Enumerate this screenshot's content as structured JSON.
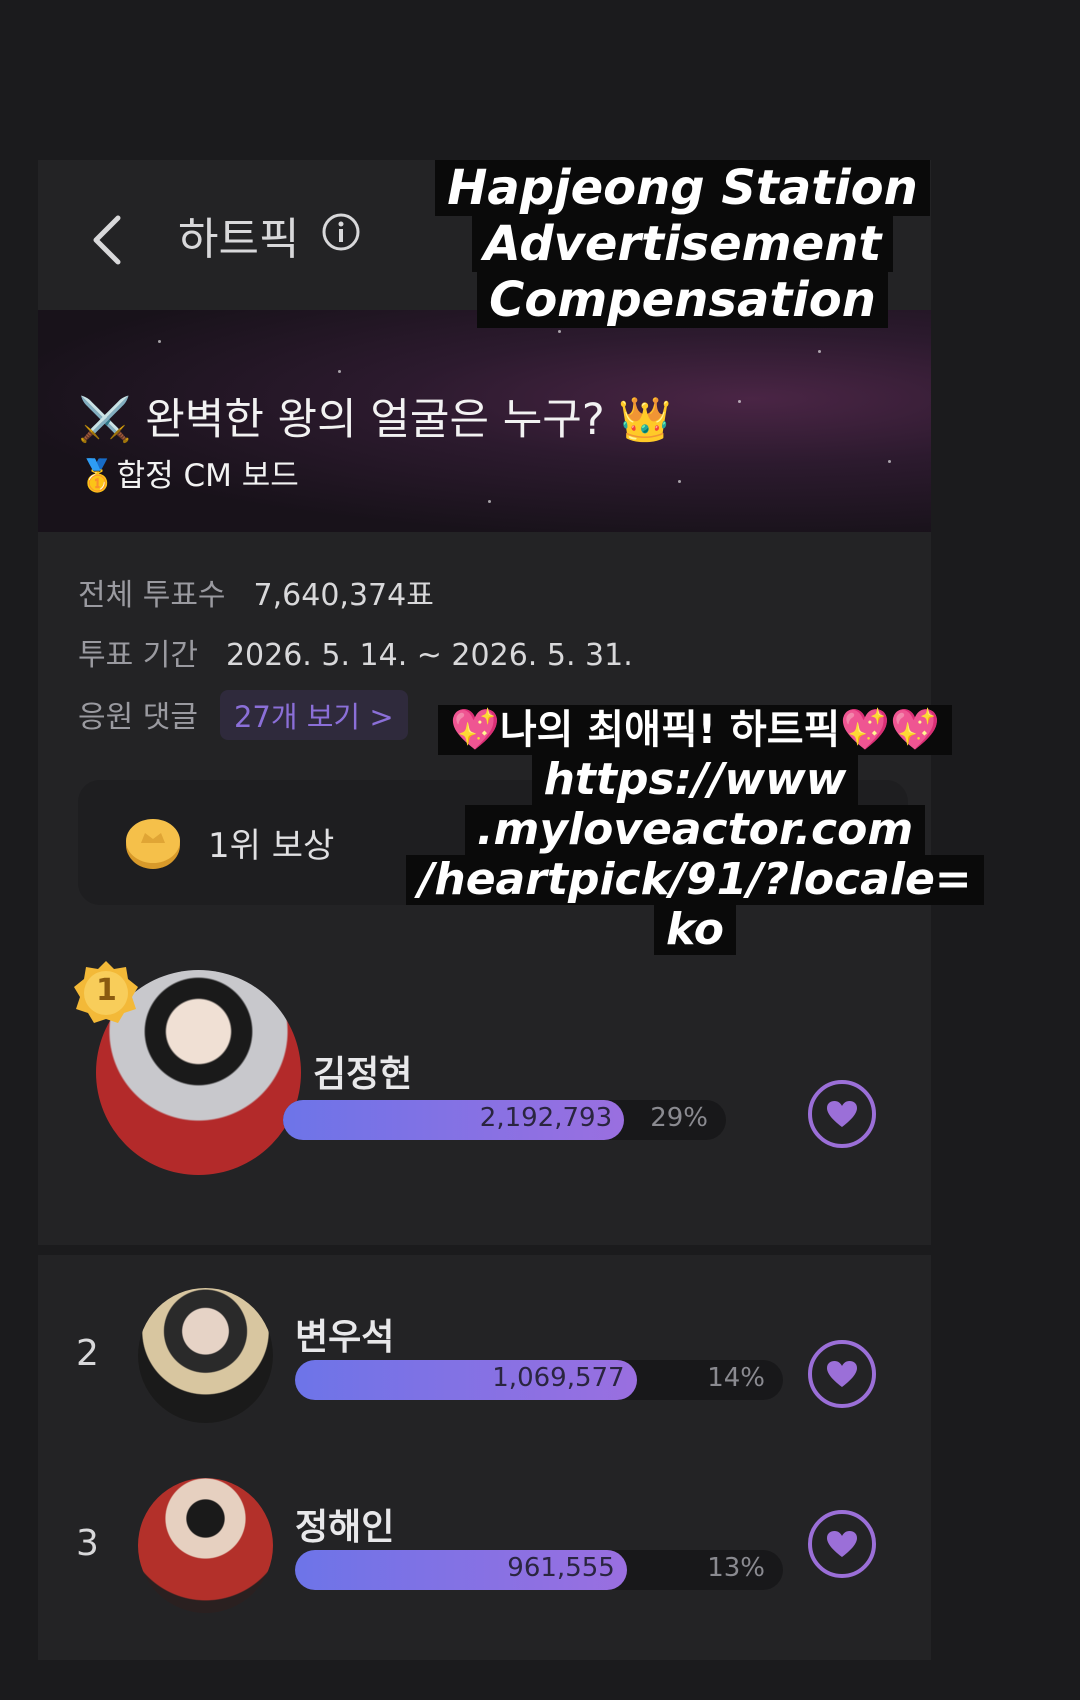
{
  "header": {
    "title": "하트픽"
  },
  "banner": {
    "title": "⚔️ 완벽한 왕의 얼굴은 누구? 👑",
    "subtitle": "🥇합정 CM 보드"
  },
  "info": {
    "total_votes_label": "전체 투표수",
    "total_votes_value": "7,640,374표",
    "period_label": "투표 기간",
    "period_value": "2026. 5. 14. ~ 2026. 5. 31.",
    "comments_label": "응원 댓글",
    "comments_link": "27개 보기 >"
  },
  "reward": {
    "label": "1위 보상"
  },
  "ranking": [
    {
      "rank": "1",
      "name": "김정현",
      "votes": "2,192,793",
      "percent": "29%",
      "fill": 0.77
    },
    {
      "rank": "2",
      "name": "변우석",
      "votes": "1,069,577",
      "percent": "14%",
      "fill": 0.7
    },
    {
      "rank": "3",
      "name": "정해인",
      "votes": "961,555",
      "percent": "13%",
      "fill": 0.68
    }
  ],
  "overlay_top": [
    "Hapjeong Station",
    "Advertisement",
    "Compensation"
  ],
  "overlay_mid": [
    "💖나의 최애픽! 하트픽💖💖",
    "https://www",
    ".myloveactor.com",
    "/heartpick/91/?locale=",
    "ko"
  ],
  "colors": {
    "accent": "#9b6fd8",
    "bar_start": "#6d74e8",
    "bar_end": "#9a6fe0",
    "background": "#232325"
  }
}
